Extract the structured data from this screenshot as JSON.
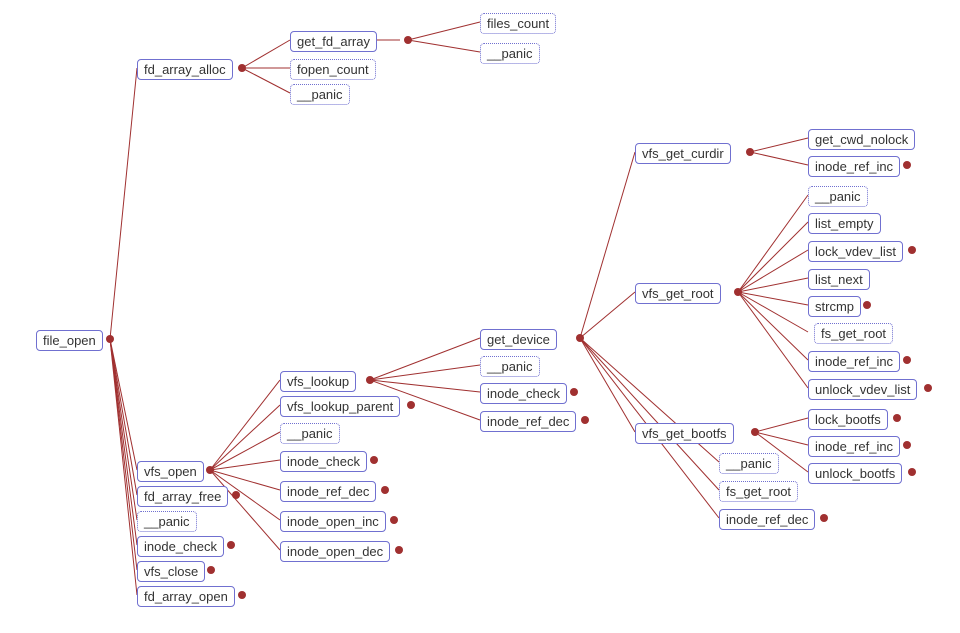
{
  "chart_data": {
    "type": "call_graph",
    "root": "file_open",
    "edges": [
      [
        "file_open",
        "fd_array_alloc"
      ],
      [
        "file_open",
        "vfs_open"
      ],
      [
        "file_open",
        "fd_array_free"
      ],
      [
        "file_open",
        "__panic"
      ],
      [
        "file_open",
        "inode_check"
      ],
      [
        "file_open",
        "vfs_close"
      ],
      [
        "file_open",
        "fd_array_open"
      ],
      [
        "fd_array_alloc",
        "get_fd_array"
      ],
      [
        "fd_array_alloc",
        "fopen_count"
      ],
      [
        "fd_array_alloc",
        "__panic"
      ],
      [
        "get_fd_array",
        "files_count"
      ],
      [
        "get_fd_array",
        "__panic"
      ],
      [
        "vfs_open",
        "vfs_lookup"
      ],
      [
        "vfs_open",
        "vfs_lookup_parent"
      ],
      [
        "vfs_open",
        "__panic"
      ],
      [
        "vfs_open",
        "inode_check"
      ],
      [
        "vfs_open",
        "inode_ref_dec"
      ],
      [
        "vfs_open",
        "inode_open_inc"
      ],
      [
        "vfs_open",
        "inode_open_dec"
      ],
      [
        "vfs_lookup",
        "get_device"
      ],
      [
        "vfs_lookup",
        "__panic"
      ],
      [
        "vfs_lookup",
        "inode_check"
      ],
      [
        "vfs_lookup",
        "inode_ref_dec"
      ],
      [
        "get_device",
        "vfs_get_curdir"
      ],
      [
        "get_device",
        "vfs_get_root"
      ],
      [
        "get_device",
        "vfs_get_bootfs"
      ],
      [
        "get_device",
        "__panic"
      ],
      [
        "get_device",
        "fs_get_root"
      ],
      [
        "get_device",
        "inode_ref_dec"
      ],
      [
        "vfs_get_curdir",
        "get_cwd_nolock"
      ],
      [
        "vfs_get_curdir",
        "inode_ref_inc"
      ],
      [
        "vfs_get_root",
        "__panic"
      ],
      [
        "vfs_get_root",
        "list_empty"
      ],
      [
        "vfs_get_root",
        "lock_vdev_list"
      ],
      [
        "vfs_get_root",
        "list_next"
      ],
      [
        "vfs_get_root",
        "strcmp"
      ],
      [
        "vfs_get_root",
        "fs_get_root"
      ],
      [
        "vfs_get_root",
        "inode_ref_inc"
      ],
      [
        "vfs_get_root",
        "unlock_vdev_list"
      ],
      [
        "vfs_get_bootfs",
        "lock_bootfs"
      ],
      [
        "vfs_get_bootfs",
        "inode_ref_inc"
      ],
      [
        "vfs_get_bootfs",
        "unlock_bootfs"
      ]
    ]
  },
  "n": {
    "file_open": "file_open",
    "fd_array_alloc": "fd_array_alloc",
    "get_fd_array": "get_fd_array",
    "files_count": "files_count",
    "panic1": "__panic",
    "panic2": "__panic",
    "panic3": "__panic",
    "panic4": "__panic",
    "panic5": "__panic",
    "panic6": "__panic",
    "panic7": "__panic",
    "fopen_count": "fopen_count",
    "vfs_open": "vfs_open",
    "fd_array_free": "fd_array_free",
    "inode_check1": "inode_check",
    "inode_check2": "inode_check",
    "inode_check3": "inode_check",
    "vfs_close": "vfs_close",
    "fd_array_open": "fd_array_open",
    "vfs_lookup": "vfs_lookup",
    "vfs_lookup_parent": "vfs_lookup_parent",
    "inode_ref_dec1": "inode_ref_dec",
    "inode_ref_dec2": "inode_ref_dec",
    "inode_ref_dec3": "inode_ref_dec",
    "inode_open_inc": "inode_open_inc",
    "inode_open_dec": "inode_open_dec",
    "get_device": "get_device",
    "vfs_get_curdir": "vfs_get_curdir",
    "vfs_get_root": "vfs_get_root",
    "vfs_get_bootfs": "vfs_get_bootfs",
    "fs_get_root1": "fs_get_root",
    "fs_get_root2": "fs_get_root",
    "get_cwd_nolock": "get_cwd_nolock",
    "inode_ref_inc1": "inode_ref_inc",
    "inode_ref_inc2": "inode_ref_inc",
    "inode_ref_inc3": "inode_ref_inc",
    "list_empty": "list_empty",
    "lock_vdev_list": "lock_vdev_list",
    "list_next": "list_next",
    "strcmp": "strcmp",
    "unlock_vdev_list": "unlock_vdev_list",
    "lock_bootfs": "lock_bootfs",
    "unlock_bootfs": "unlock_bootfs"
  }
}
